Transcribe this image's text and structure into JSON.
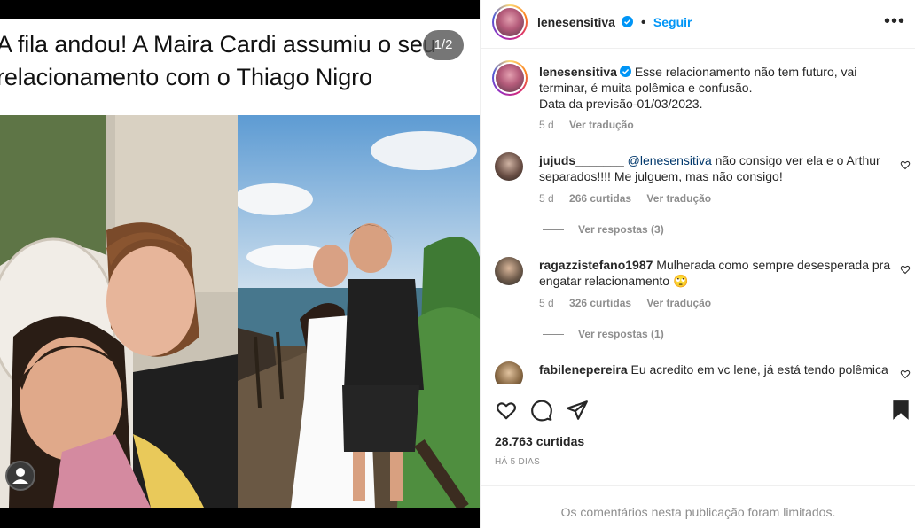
{
  "media": {
    "headline": "A fila andou! A Maira Cardi assumiu o seu relacionamento com o Thiago Nigro",
    "counter": "1/2"
  },
  "post": {
    "author": "lenesensitiva",
    "follow_label": "Seguir",
    "caption_lines": [
      "Esse relacionamento não tem futuro, vai",
      "terminar, é muita polêmica e confusão.",
      "Data da previsão-01/03/2023."
    ],
    "caption_age": "5 d",
    "translate_label": "Ver tradução",
    "likes": "28.763 curtidas",
    "date": "HÁ 5 DIAS",
    "limited_notice": "Os comentários nesta publicação foram limitados."
  },
  "comments": [
    {
      "user": "jujuds_______",
      "mention": "@lenesensitiva",
      "line1": " não consigo ver ela e o Arthur",
      "line2": "separados!!!! Me julguem, mas não consigo!",
      "age": "5 d",
      "likes": "266 curtidas",
      "translate": "Ver tradução",
      "replies": "Ver respostas (3)"
    },
    {
      "user": "ragazzistefano1987",
      "line1": " Mulherada como sempre desesperada pra",
      "line2": "engatar relacionamento 🙄",
      "age": "5 d",
      "likes": "326 curtidas",
      "translate": "Ver tradução",
      "replies": "Ver respostas (1)"
    },
    {
      "user": "fabilenepereira",
      "line1": " Eu acredito em vc lene, já está tendo polêmica"
    }
  ],
  "colors": {
    "follow": "#0095f6",
    "verified": "#0095f6",
    "muted": "#8e8e8e",
    "text": "#262626"
  },
  "icons": [
    "more-options-icon",
    "verified-icon",
    "heart-icon",
    "comment-icon",
    "share-icon",
    "bookmark-icon",
    "user-tag-icon"
  ]
}
